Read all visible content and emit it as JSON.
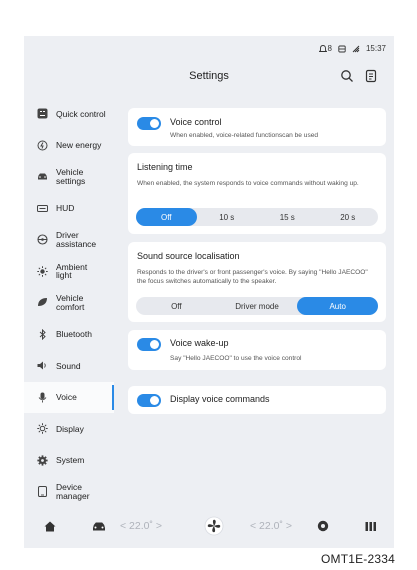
{
  "status": {
    "left_icon_value": "8",
    "time": "15:37"
  },
  "header": {
    "title": "Settings",
    "icons": [
      "search-icon",
      "notes-icon"
    ]
  },
  "sidebar": {
    "active": "Voice",
    "items": [
      {
        "label": "Quick control",
        "icon": "quick-control-icon"
      },
      {
        "label": "New energy",
        "icon": "new-energy-icon"
      },
      {
        "label": "Vehicle\nsettings",
        "icon": "car-icon"
      },
      {
        "label": "HUD",
        "icon": "hud-icon"
      },
      {
        "label": "Driver\nassistance",
        "icon": "steering-wheel-icon"
      },
      {
        "label": "Ambient\nlight",
        "icon": "ambient-light-icon"
      },
      {
        "label": "Vehicle\ncomfort",
        "icon": "comfort-icon"
      },
      {
        "label": "Bluetooth",
        "icon": "bluetooth-icon"
      },
      {
        "label": "Sound",
        "icon": "speaker-icon"
      },
      {
        "label": "Voice",
        "icon": "microphone-icon"
      },
      {
        "label": "Display",
        "icon": "brightness-icon"
      },
      {
        "label": "System",
        "icon": "gear-icon"
      },
      {
        "label": "Device\nmanager",
        "icon": "device-icon"
      }
    ]
  },
  "voice_control": {
    "title": "Voice control",
    "desc": "When enabled, voice-related functionscan be used",
    "enabled": true
  },
  "listening_time": {
    "title": "Listening time",
    "desc": "When enabled, the system responds to voice commands without waking up.",
    "options": [
      "Off",
      "10 s",
      "15 s",
      "20 s"
    ],
    "selected": "Off"
  },
  "sound_source": {
    "title": "Sound source localisation",
    "desc": "Responds to the driver's or front passenger's voice. By saying \"Hello JAECOO\" the focus switches automatically to the speaker.",
    "options": [
      "Off",
      "Driver mode",
      "Auto"
    ],
    "selected": "Auto"
  },
  "voice_wakeup": {
    "title": "Voice wake-up",
    "desc": "Say \"Hello JAECOO\" to use the voice control",
    "enabled": true
  },
  "display_commands": {
    "title": "Display voice commands",
    "enabled": true
  },
  "bottom_bar": {
    "temp_left": "< 22.0˚ >",
    "temp_right": "< 22.0˚ >"
  },
  "caption": "OMT1E-2334",
  "colors": {
    "accent": "#2a8ae6",
    "screen_bg": "#edeff3",
    "card_bg": "#ffffff"
  }
}
